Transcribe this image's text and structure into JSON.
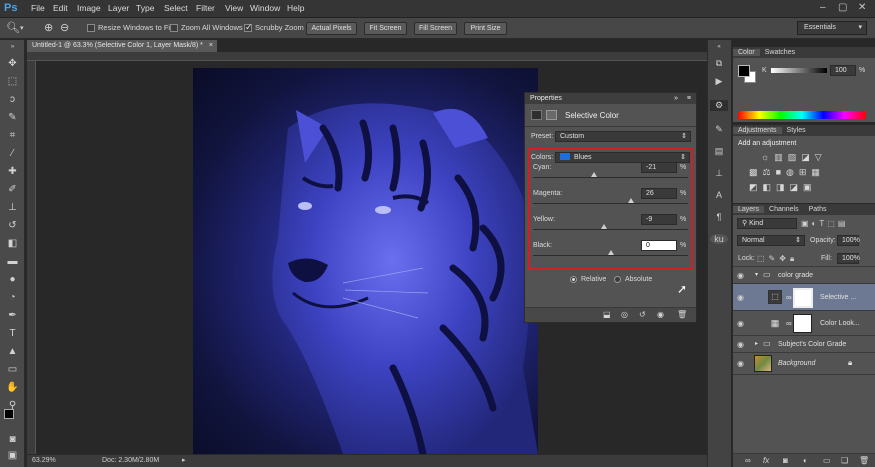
{
  "app": {
    "logo": "Ps"
  },
  "menu": [
    "File",
    "Edit",
    "Image",
    "Layer",
    "Type",
    "Select",
    "Filter",
    "View",
    "Window",
    "Help"
  ],
  "window_controls": [
    "–",
    "▢",
    "✕"
  ],
  "options_bar": {
    "resize_label": "Resize Windows to Fit",
    "zoom_all_label": "Zoom All Windows",
    "scrubby_label": "Scrubby Zoom",
    "buttons": [
      "Actual Pixels",
      "Fit Screen",
      "Fill Screen",
      "Print Size"
    ],
    "workspace": "Essentials"
  },
  "document": {
    "tab_title": "Untitled-1 @ 63.3% (Selective Color 1, Layer Mask/8) *",
    "close": "×",
    "zoom": "63.29%",
    "doc_info": "Doc: 2.30M/2.80M"
  },
  "properties": {
    "tab": "Properties",
    "title": "Selective Color",
    "preset_label": "Preset:",
    "preset_value": "Custom",
    "colors_label": "Colors:",
    "colors_value": "Blues",
    "sliders": [
      {
        "label": "Cyan:",
        "value": "-21",
        "unit": "%",
        "level": -21
      },
      {
        "label": "Magenta:",
        "value": "26",
        "unit": "%",
        "level": 26
      },
      {
        "label": "Yellow:",
        "value": "-9",
        "unit": "%",
        "level": -9
      },
      {
        "label": "Black:",
        "value": "0",
        "unit": "%",
        "level": 0
      }
    ],
    "relative_label": "Relative",
    "absolute_label": "Absolute",
    "accent_color": "#1e6fd9",
    "highlight_color": "#d11f26"
  },
  "color_panel": {
    "tabs": [
      "Color",
      "Swatches"
    ],
    "channel": "K",
    "value": "100",
    "unit": "%"
  },
  "adjustments_panel": {
    "tabs": [
      "Adjustments",
      "Styles"
    ],
    "heading": "Add an adjustment"
  },
  "layers_panel": {
    "tabs": [
      "Layers",
      "Channels",
      "Paths"
    ],
    "filter_kind": "Kind",
    "blend_mode": "Normal",
    "opacity_label": "Opacity:",
    "opacity_value": "100%",
    "lock_label": "Lock:",
    "fill_label": "Fill:",
    "fill_value": "100%",
    "layers": [
      {
        "name": "color grade",
        "type": "group"
      },
      {
        "name": "Selective ...",
        "type": "adjustment"
      },
      {
        "name": "Color Look...",
        "type": "adjustment"
      },
      {
        "name": "Subject's Color Grade",
        "type": "group"
      },
      {
        "name": "Background",
        "type": "image"
      }
    ],
    "footer_icons": [
      "link-icon",
      "fx-icon",
      "mask-icon",
      "adjustment-icon",
      "folder-icon",
      "new-layer-icon",
      "trash-icon"
    ]
  }
}
